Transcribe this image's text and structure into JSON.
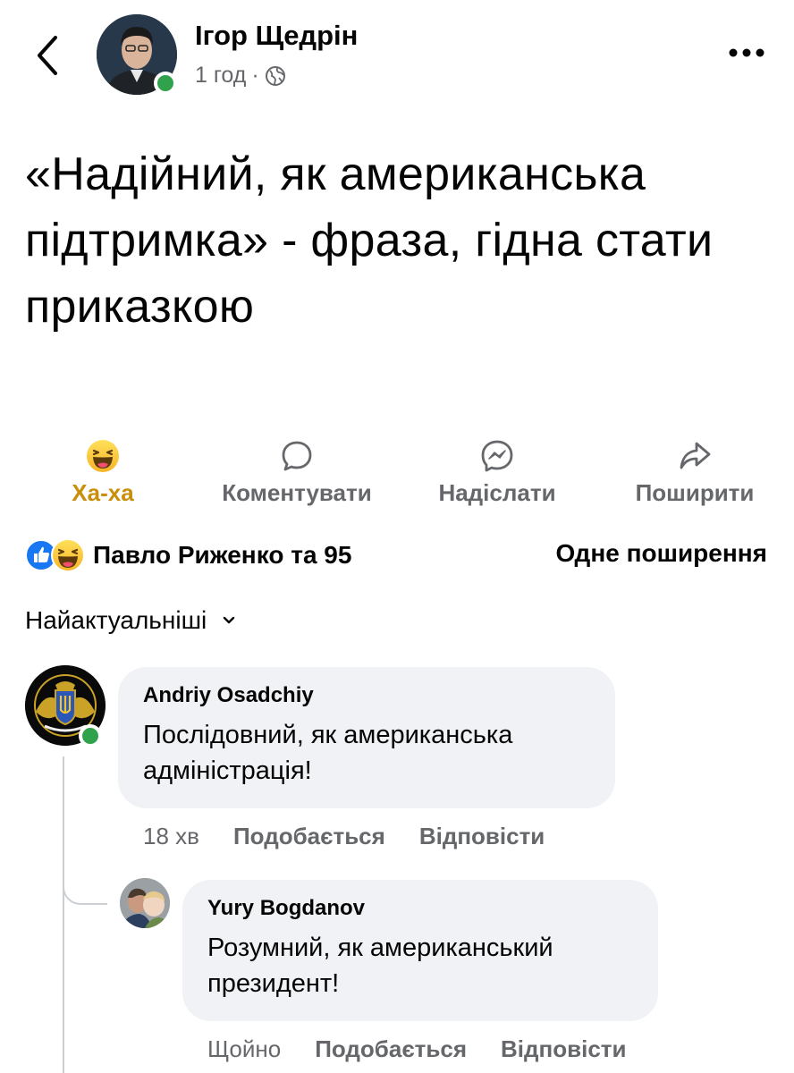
{
  "header": {
    "author": "Ігор Щедрін",
    "time": "1 год",
    "separator": "·",
    "privacy_icon": "globe-icon",
    "back_icon": "chevron-left-icon",
    "more_icon": "more-dots-icon"
  },
  "post": {
    "text": "«Надійний, як американська підтримка» - фраза, гідна стати приказкою"
  },
  "actions": [
    {
      "label": "Ха-ха",
      "icon": "haha-emoji-icon",
      "active": true
    },
    {
      "label": "Коментувати",
      "icon": "comment-icon",
      "active": false
    },
    {
      "label": "Надіслати",
      "icon": "messenger-icon",
      "active": false
    },
    {
      "label": "Поширити",
      "icon": "share-icon",
      "active": false
    }
  ],
  "reactions": {
    "icons": [
      "like-icon",
      "haha-icon"
    ],
    "summary": "Павло Риженко та 95",
    "shares": "Одне поширення"
  },
  "sort": {
    "label": "Найактуальніші",
    "icon": "chevron-down-icon"
  },
  "comments": [
    {
      "author": "Andriy Osadchiy",
      "text": "Послідовний, як американська адміністрація!",
      "time": "18 хв",
      "like": "Подобається",
      "reply": "Відповісти"
    },
    {
      "author": "Yury Bogdanov",
      "text": "Розумний, як американський президент!",
      "time": "Щойно",
      "like": "Подобається",
      "reply": "Відповісти"
    }
  ],
  "colors": {
    "accent_haha": "#c98f0a",
    "secondary_text": "#65676b",
    "bubble_bg": "#f0f2f5",
    "online": "#31a24c",
    "like_blue": "#1877f2"
  }
}
